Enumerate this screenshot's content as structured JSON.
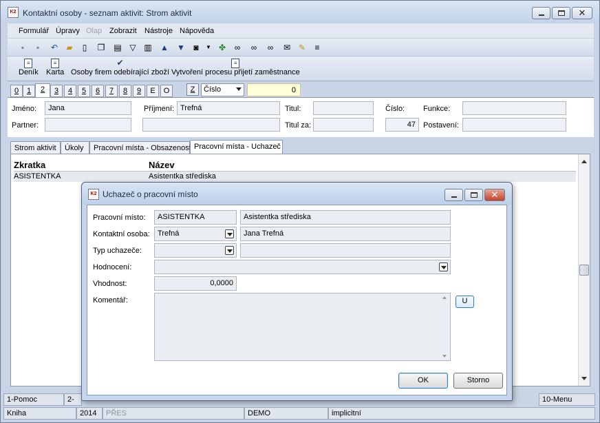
{
  "window": {
    "title": "Kontaktní osoby - seznam aktivit: Strom aktivit",
    "icon": "K2"
  },
  "menu": [
    "Formulář",
    "Úpravy",
    "Olap",
    "Zobrazit",
    "Nástroje",
    "Nápověda"
  ],
  "toolbar2": {
    "denik": "Deník",
    "karta": "Karta",
    "osoby": "Osoby firem odebírající zboží",
    "vytvoreni": "Vytvoření procesu přijetí zaměstnance"
  },
  "pagetabs": [
    "0",
    "1",
    "2",
    "3",
    "4",
    "5",
    "6",
    "7",
    "8",
    "9",
    "E",
    "O"
  ],
  "pagetab_active": "2",
  "zbutton": "Z",
  "sort_select": "Číslo",
  "sort_value": "0",
  "header": {
    "jmeno_label": "Jméno:",
    "jmeno": "Jana",
    "prijmeni_label": "Příjmení:",
    "prijmeni": "Trefná",
    "titul_label": "Titul:",
    "titul": "",
    "cislo_label": "Číslo:",
    "cislo": "47",
    "funkce_label": "Funkce:",
    "funkce": "",
    "partner_label": "Partner:",
    "partner": "",
    "partner2": "",
    "titul_za_label": "Titul za:",
    "titul_za": "",
    "postaveni_label": "Postavení:",
    "postaveni": ""
  },
  "tabs": [
    "Strom aktivit",
    "Úkoly",
    "Pracovní místa - Obsazenost",
    "Pracovní místa - Uchazeč"
  ],
  "grid": {
    "columns": [
      "Zkratka",
      "Název"
    ],
    "rows": [
      [
        "ASISTENTKA",
        "Asistentka střediska"
      ]
    ]
  },
  "status": {
    "help": "1-Pomoc",
    "f2": "2-",
    "menu": "10-Menu",
    "book": "Kniha",
    "year": "2014",
    "pres": "PŘES",
    "demo": "DEMO",
    "implicit": "implicitní"
  },
  "dialog": {
    "title": "Uchazeč o pracovní místo",
    "pracovni_misto_label": "Pracovní místo:",
    "pracovni_misto_code": "ASISTENTKA",
    "pracovni_misto_name": "Asistentka střediska",
    "kontakt_label": "Kontaktní osoba:",
    "kontakt_value": "Trefná",
    "kontakt_name": "Jana Trefná",
    "typ_label": "Typ uchazeče:",
    "typ_value": "",
    "typ_name": "",
    "hodnoceni_label": "Hodnocení:",
    "hodnoceni_value": "",
    "vhodnost_label": "Vhodnost:",
    "vhodnost_value": "0,0000",
    "komentar_label": "Komentář:",
    "komentar_value": "",
    "u_button": "U",
    "ok": "OK",
    "storno": "Storno"
  }
}
